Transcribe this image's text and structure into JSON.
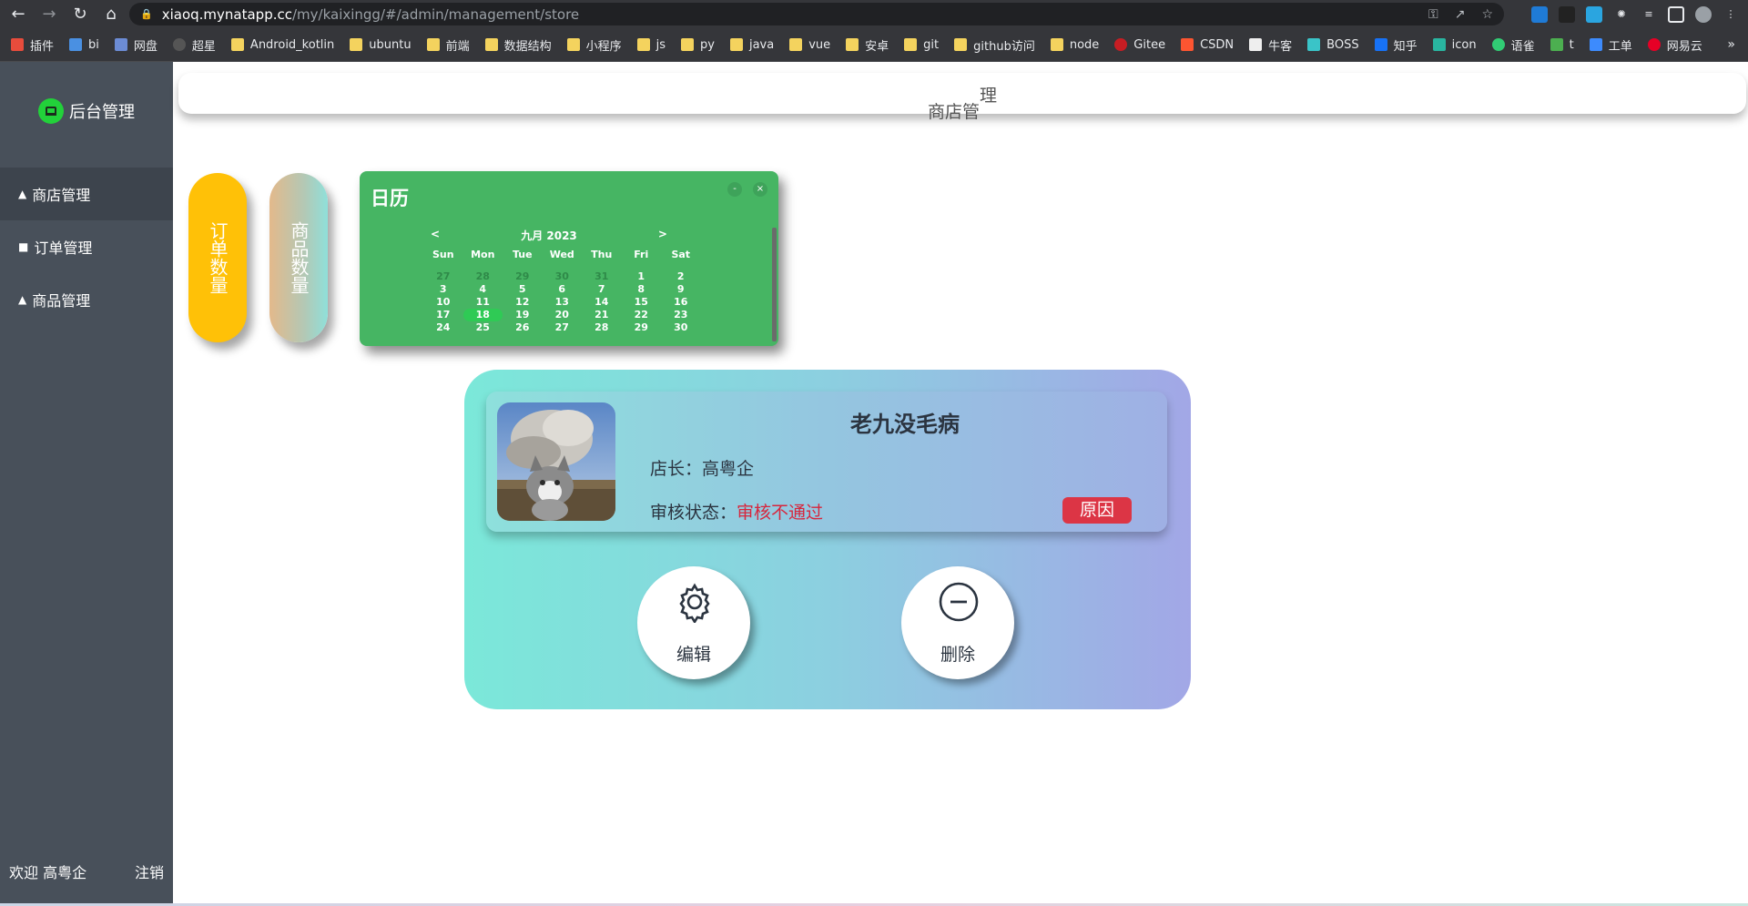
{
  "browser": {
    "url_host": "xiaoq.mynatapp.cc",
    "url_path": "/my/kaixingg/#/admin/management/store",
    "bookmarks": [
      "插件",
      "bi",
      "网盘",
      "超星",
      "Android_kotlin",
      "ubuntu",
      "前端",
      "数据结构",
      "小程序",
      "js",
      "py",
      "java",
      "vue",
      "安卓",
      "git",
      "github访问",
      "node",
      "Gitee",
      "CSDN",
      "牛客",
      "BOSS",
      "知乎",
      "icon",
      "语雀",
      "t",
      "工单",
      "网易云"
    ],
    "more": "»"
  },
  "sidebar": {
    "brand": "后台管理",
    "items": [
      {
        "label": "商店管理"
      },
      {
        "label": "订单管理"
      },
      {
        "label": "商品管理"
      }
    ],
    "welcome": "欢迎 高粤企",
    "logout": "注销"
  },
  "header": {
    "title_main": "商店管",
    "title_sup": "理"
  },
  "stats": {
    "orders_label": "订单数量",
    "goods_label": "商品数量"
  },
  "calendar": {
    "title": "日历",
    "min_label": "-",
    "close_label": "×",
    "prev": "<",
    "next": ">",
    "month_label": "九月 2023",
    "weekdays": [
      "Sun",
      "Mon",
      "Tue",
      "Wed",
      "Thu",
      "Fri",
      "Sat"
    ],
    "weeks": [
      [
        "27",
        "28",
        "29",
        "30",
        "31",
        "1",
        "2"
      ],
      [
        "3",
        "4",
        "5",
        "6",
        "7",
        "8",
        "9"
      ],
      [
        "10",
        "11",
        "12",
        "13",
        "14",
        "15",
        "16"
      ],
      [
        "17",
        "18",
        "19",
        "20",
        "21",
        "22",
        "23"
      ],
      [
        "24",
        "25",
        "26",
        "27",
        "28",
        "29",
        "30"
      ]
    ],
    "today": "18"
  },
  "store": {
    "name": "老九没毛病",
    "owner_label": "店长：",
    "owner": "高粤企",
    "audit_label": "审核状态：",
    "audit_status": "审核不通过",
    "reason_button": "原因",
    "edit_label": "编辑",
    "delete_label": "删除"
  },
  "colors": {
    "sidebar": "#48505a",
    "calendar": "#46b563",
    "orders_pill": "#ffc107",
    "danger": "#dc3545"
  }
}
